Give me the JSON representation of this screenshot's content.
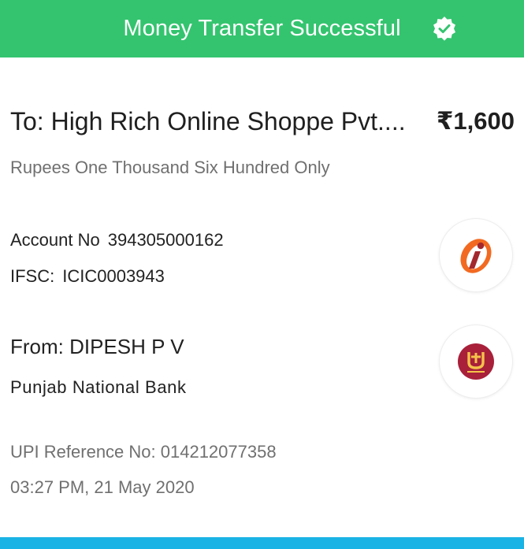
{
  "header": {
    "title": "Money Transfer Successful",
    "icon": "verified-check-icon",
    "background": "#34c46f"
  },
  "recipient": {
    "label": "To:",
    "name": "High Rich Online Shoppe Pvt....",
    "amount": "₹1,600",
    "amount_words": "Rupees One Thousand Six Hundred Only",
    "account_label": "Account No",
    "account_number": "394305000162",
    "ifsc_label": "IFSC:",
    "ifsc": "ICIC0003943",
    "bank_logo": "icici-bank-logo"
  },
  "sender": {
    "label": "From:",
    "name": "DIPESH P V",
    "bank": "Punjab National Bank",
    "bank_logo": "pnb-bank-logo"
  },
  "transaction": {
    "reference": "UPI Reference No: 014212077358",
    "datetime": "03:27 PM, 21 May 2020"
  },
  "colors": {
    "accent_green": "#34c46f",
    "bottom_bar": "#1ab3e6",
    "icici_orange": "#f26a21",
    "icici_maroon": "#a3282d",
    "pnb_maroon": "#a8203a"
  }
}
